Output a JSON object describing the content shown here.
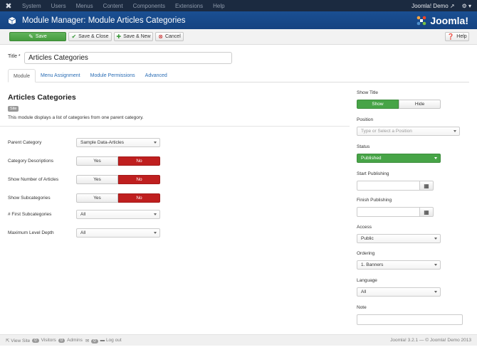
{
  "topnav": {
    "menus": [
      "System",
      "Users",
      "Menus",
      "Content",
      "Components",
      "Extensions",
      "Help"
    ],
    "user": "Joomla! Demo"
  },
  "header": {
    "title": "Module Manager: Module Articles Categories",
    "brand": "Joomla!"
  },
  "toolbar": {
    "save": "Save",
    "save_close": "Save & Close",
    "save_new": "Save & New",
    "cancel": "Cancel",
    "help": "Help"
  },
  "form": {
    "title_label": "Title *",
    "title_value": "Articles Categories"
  },
  "tabs": [
    "Module",
    "Menu Assignment",
    "Module Permissions",
    "Advanced"
  ],
  "module": {
    "heading": "Articles Categories",
    "badge": "Site",
    "description": "This module displays a list of categories from one parent category."
  },
  "fields": {
    "parent_category": {
      "label": "Parent Category",
      "value": "Sample Data-Articles"
    },
    "category_descriptions": {
      "label": "Category Descriptions",
      "yes": "Yes",
      "no": "No"
    },
    "show_number_articles": {
      "label": "Show Number of Articles",
      "yes": "Yes",
      "no": "No"
    },
    "show_subcategories": {
      "label": "Show Subcategories",
      "yes": "Yes",
      "no": "No"
    },
    "first_subcategories": {
      "label": "# First Subcategories",
      "value": "All"
    },
    "max_level_depth": {
      "label": "Maximum Level Depth",
      "value": "All"
    }
  },
  "sidebar": {
    "show_title": {
      "label": "Show Title",
      "show": "Show",
      "hide": "Hide"
    },
    "position": {
      "label": "Position",
      "placeholder": "Type or Select a Position"
    },
    "status": {
      "label": "Status",
      "value": "Published"
    },
    "start_publishing": {
      "label": "Start Publishing"
    },
    "finish_publishing": {
      "label": "Finish Publishing"
    },
    "access": {
      "label": "Access",
      "value": "Public"
    },
    "ordering": {
      "label": "Ordering",
      "value": "1. Banners"
    },
    "language": {
      "label": "Language",
      "value": "All"
    },
    "note": {
      "label": "Note"
    }
  },
  "footer": {
    "view_site": "View Site",
    "visitors_count": "0",
    "visitors": "Visitors",
    "admins_count": "0",
    "admins": "Admins",
    "messages_count": "0",
    "logout": "Log out",
    "copyright": "Joomla! 3.2.1 — © Joomla! Demo 2013"
  },
  "colors": {
    "nav_bg": "#1b2a40",
    "header_bg": "#1a4f92",
    "save_green": "#469c3f",
    "no_red": "#bf1f1f",
    "published_green": "#47a447"
  }
}
